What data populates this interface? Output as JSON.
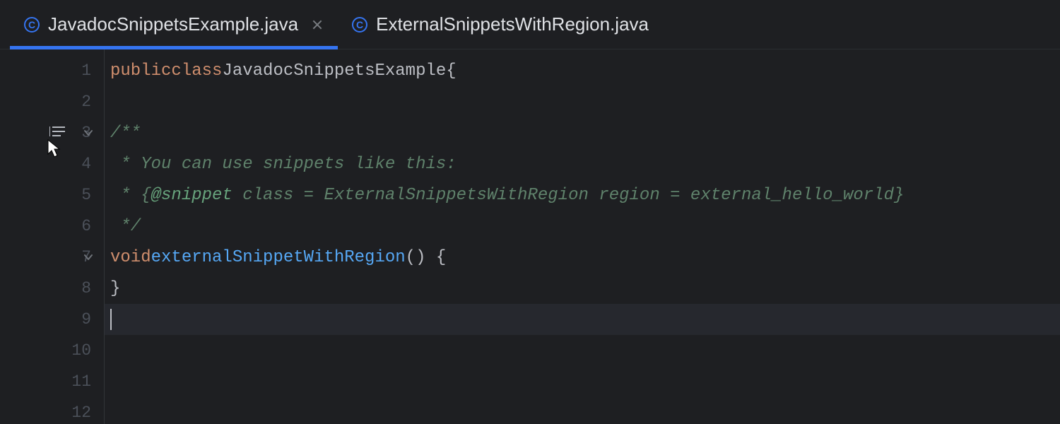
{
  "tabs": [
    {
      "label": "JavadocSnippetsExample.java",
      "iconLetter": "C",
      "active": true,
      "closeable": true
    },
    {
      "label": "ExternalSnippetsWithRegion.java",
      "iconLetter": "C",
      "active": false,
      "closeable": false
    }
  ],
  "gutter": {
    "lines": [
      "1",
      "2",
      "3",
      "4",
      "5",
      "6",
      "7",
      "8",
      "9",
      "10",
      "11",
      "12"
    ],
    "foldAt": [
      3,
      7
    ],
    "renderIconAt": 3,
    "currentLine": 9
  },
  "code": {
    "line1": {
      "kw1": "public",
      "kw2": "class",
      "cls": "JavadocSnippetsExample",
      "brace": "{"
    },
    "line3": {
      "doc": "/**"
    },
    "line4": {
      "doc": " * You can use snippets like this:"
    },
    "line5": {
      "star": " * {",
      "tag": "@snippet",
      "rest": " class = ExternalSnippetsWithRegion region = external_hello_world}"
    },
    "line6": {
      "doc": " */"
    },
    "line7": {
      "kw": "void",
      "mth": "externalSnippetWithRegion",
      "parens": "() {"
    },
    "line8": {
      "brace": "}"
    }
  }
}
